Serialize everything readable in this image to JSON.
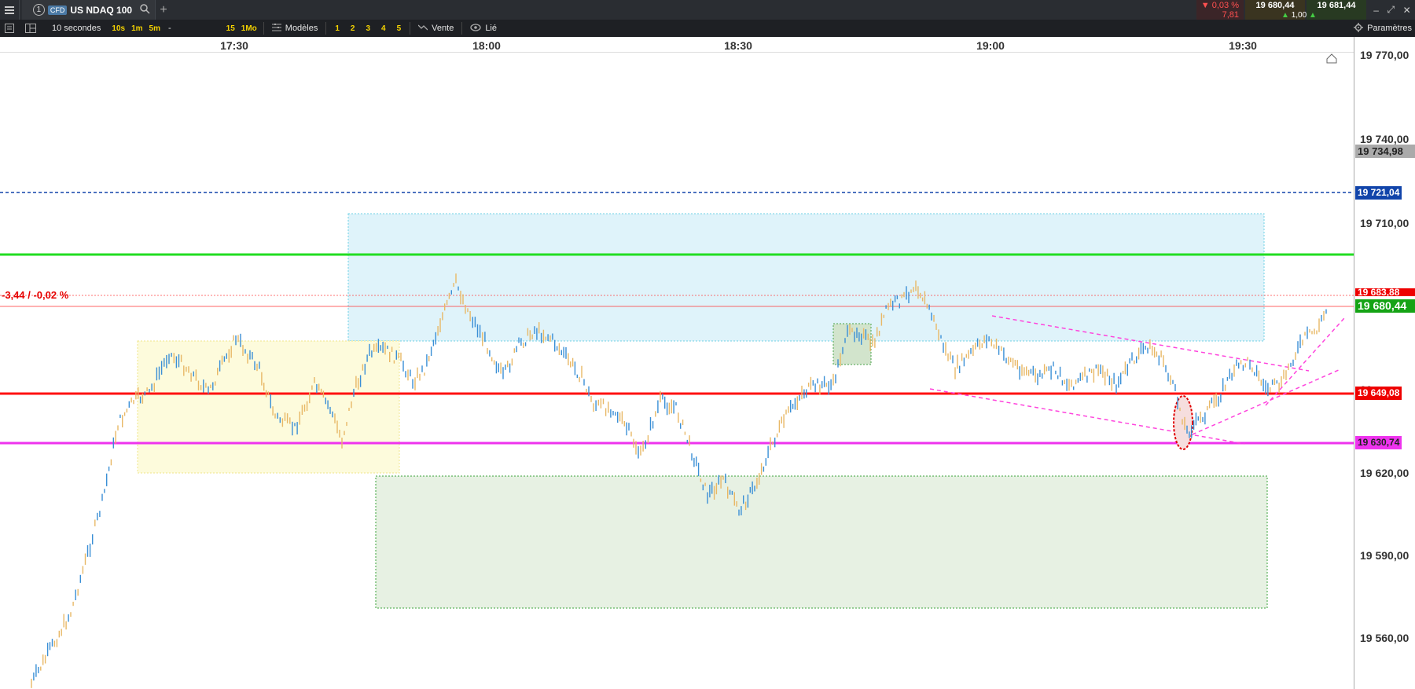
{
  "topbar": {
    "menu_icon": "hamburger-icon",
    "tab_number": "1",
    "cfd_badge": "CFD",
    "instrument": "US NDAQ 100",
    "change_pct": "▼ 0,03 %",
    "change_abs": "7,81",
    "bid": "19 680,44",
    "ask": "19 681,44",
    "spread": "1,00"
  },
  "toolbar": {
    "interval": "10 secondes",
    "quick_intervals": [
      "10s",
      "1m",
      "5m"
    ],
    "dash": "-",
    "range_15": "15",
    "range_1mo": "1Mo",
    "models_label": "Modèles",
    "slots": [
      "1",
      "2",
      "3",
      "4",
      "5"
    ],
    "sell_label": "Vente",
    "linked_label": "Lié",
    "params_label": "Paramètres"
  },
  "axes": {
    "time_labels": [
      "17:30",
      "18:00",
      "18:30",
      "19:00",
      "19:30"
    ],
    "price_labels": [
      "19 770,00",
      "19 740,00",
      "19 710,00",
      "19 620,00",
      "19 590,00",
      "19 560,00"
    ],
    "partial_label": "00"
  },
  "tags": {
    "high_price": "19 734,98",
    "blue_level": "19 721,04",
    "red_level_hidden": "19 683,88",
    "last_price": "19 680,44",
    "red_level": "19 649,08",
    "magenta_level": "19 630,74",
    "pct_change": "-3,44 / -0,02 %"
  },
  "colors": {
    "green_line": "#22dd22",
    "red_line": "#ff1111",
    "magenta_line": "#ee33ee",
    "blue_dashed": "#1144aa",
    "up_candle": "#3a8fd6",
    "down_candle": "#e8b866"
  }
}
